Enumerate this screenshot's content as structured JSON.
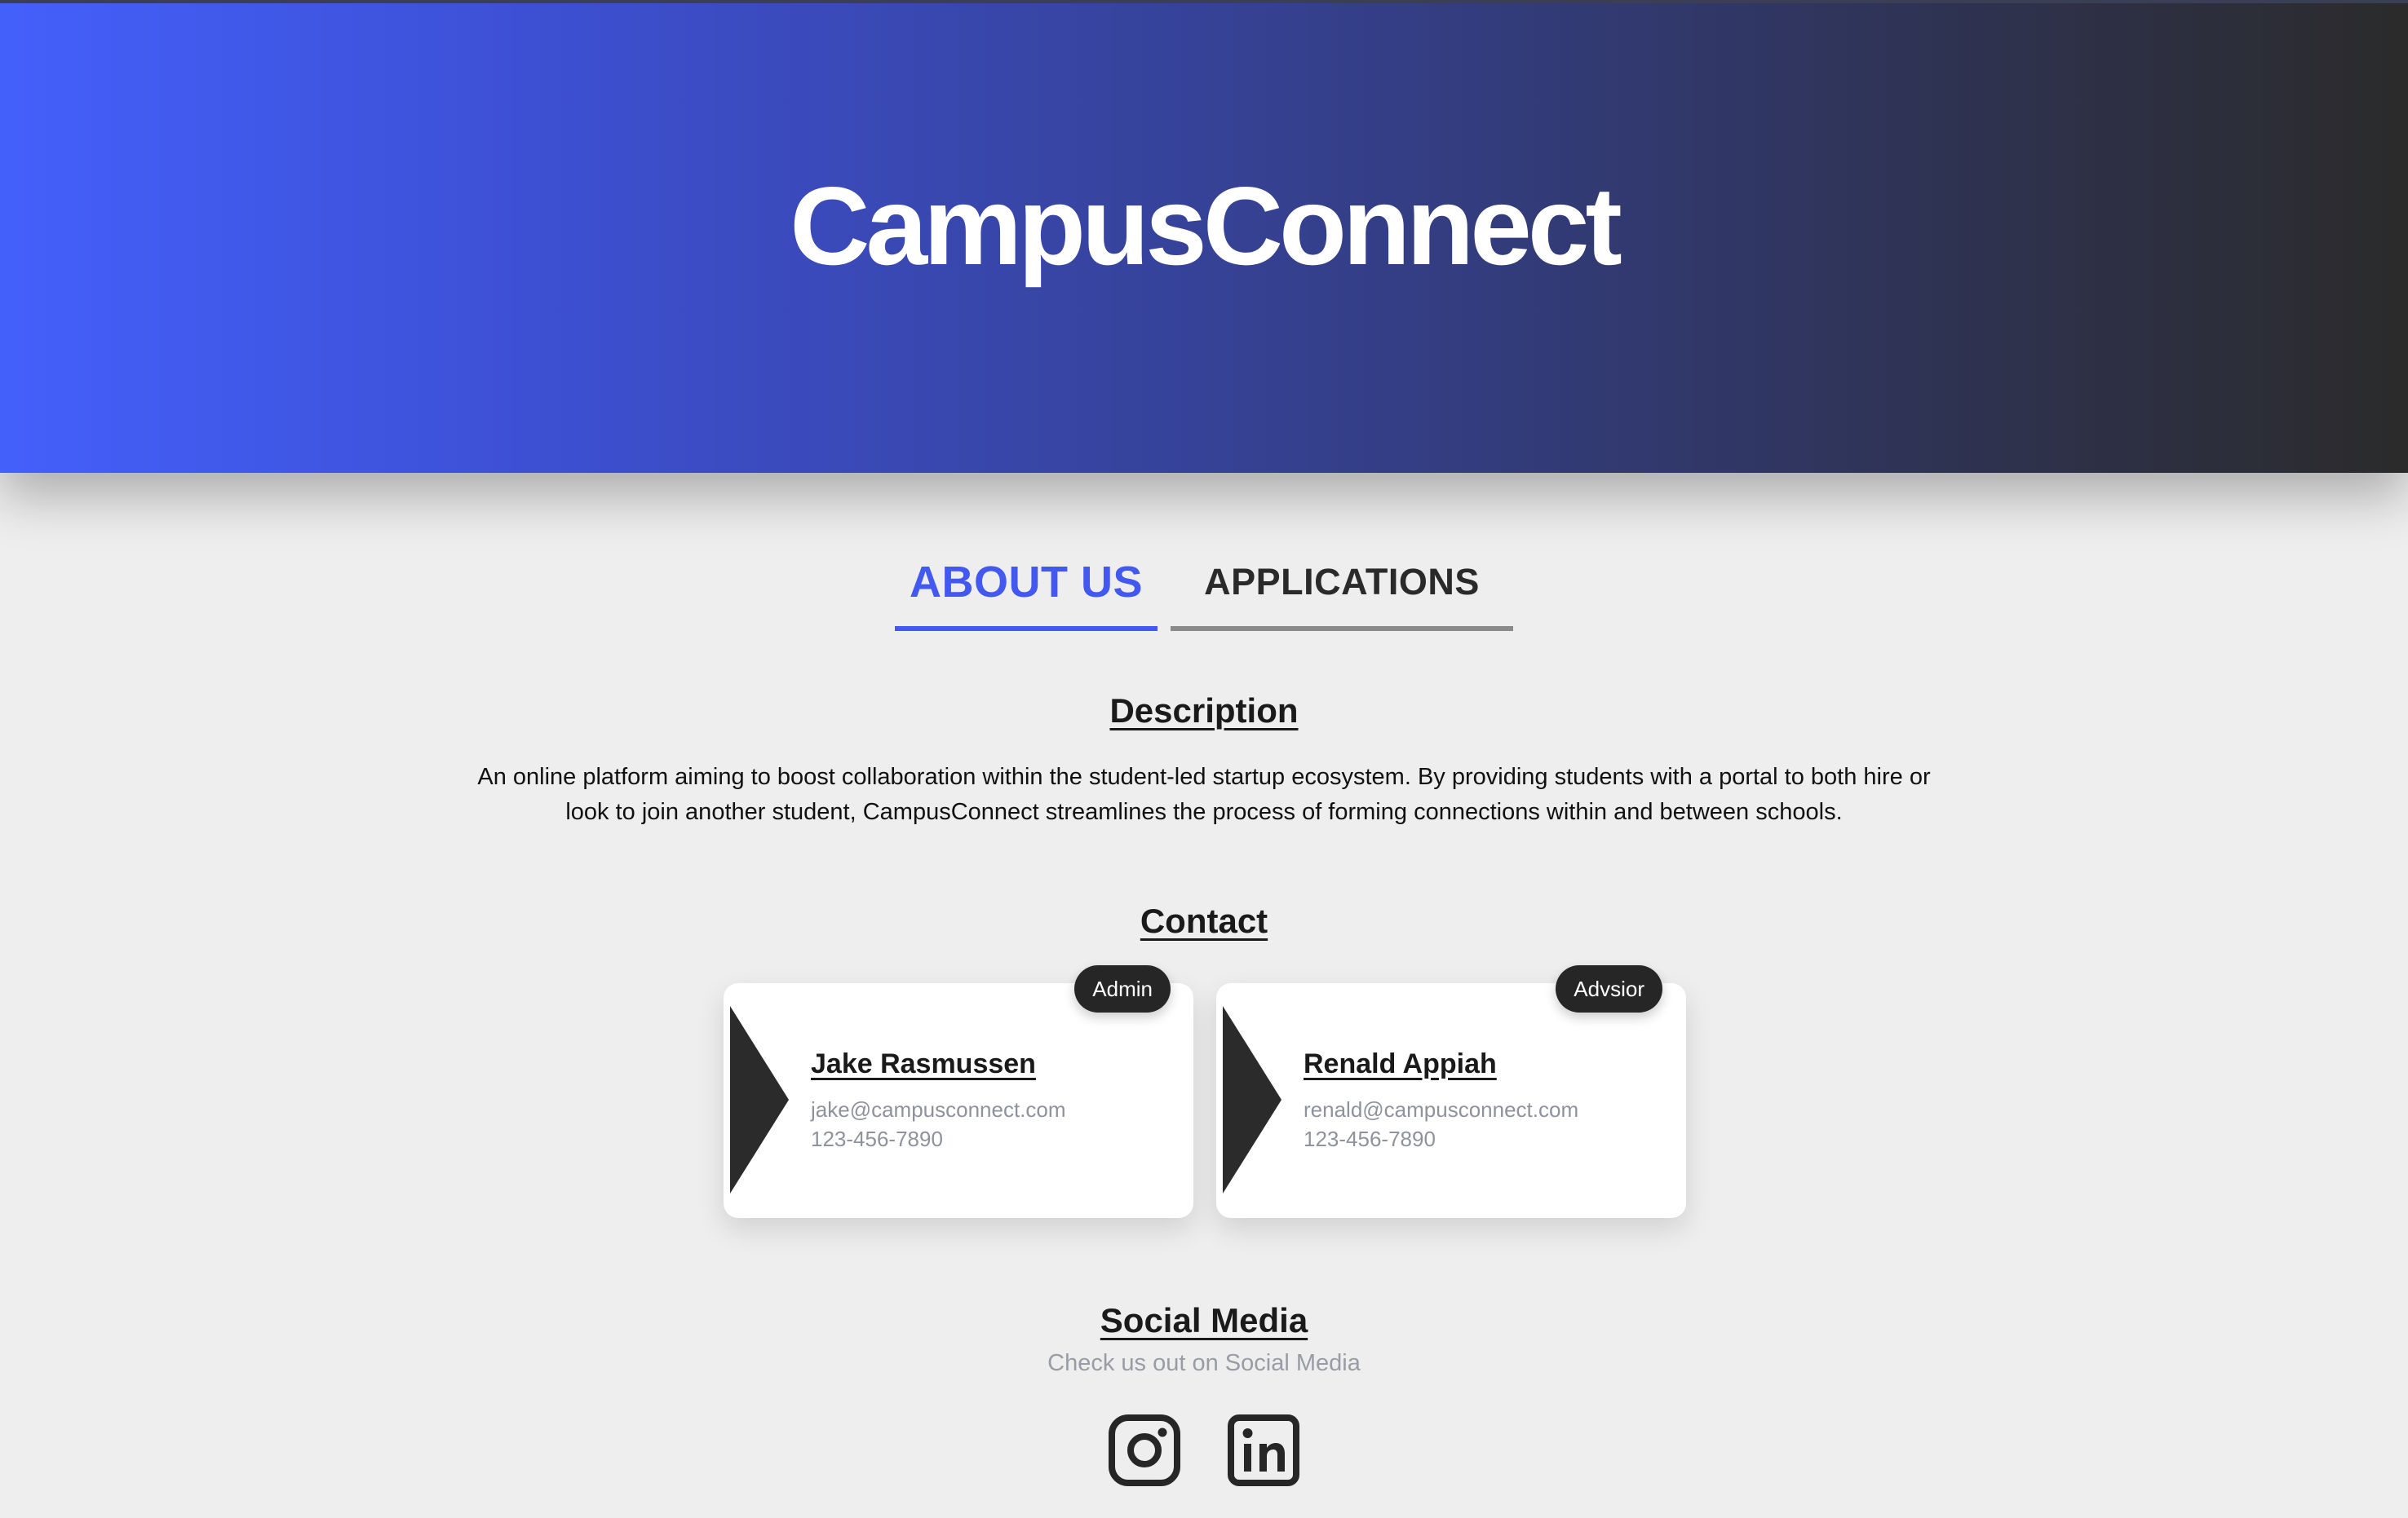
{
  "header": {
    "title": "CampusConnect"
  },
  "tabs": [
    {
      "label": "ABOUT US",
      "active": true
    },
    {
      "label": "APPLICATIONS",
      "active": false
    }
  ],
  "description": {
    "heading": "Description",
    "text": "An online platform aiming to boost collaboration within the student-led startup ecosystem. By providing students with a portal to both hire or look to join another student, CampusConnect streamlines the process of forming connections within and between schools."
  },
  "contact": {
    "heading": "Contact",
    "cards": [
      {
        "badge": "Admin",
        "name": "Jake Rasmussen",
        "email": "jake@campusconnect.com",
        "phone": "123-456-7890"
      },
      {
        "badge": "Advsior",
        "name": "Renald Appiah",
        "email": "renald@campusconnect.com",
        "phone": "123-456-7890"
      }
    ]
  },
  "social": {
    "heading": "Social Media",
    "subtitle": "Check us out on Social Media",
    "icons": [
      "instagram-icon",
      "linkedin-icon"
    ]
  },
  "colors": {
    "accent": "#4258ee",
    "dark": "#262626",
    "background": "#eeeeee"
  }
}
